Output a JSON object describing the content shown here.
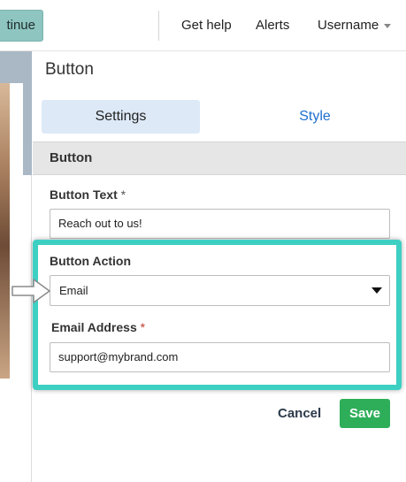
{
  "topnav": {
    "continue_label": "tinue",
    "get_help": "Get help",
    "alerts": "Alerts",
    "username": "Username"
  },
  "panel": {
    "title": "Button",
    "tabs": [
      {
        "label": "Settings",
        "active": true
      },
      {
        "label": "Style",
        "active": false
      }
    ],
    "section_header": "Button",
    "fields": {
      "button_text": {
        "label": "Button Text",
        "required_mark": "*",
        "value": "Reach out to us!"
      },
      "button_action": {
        "label": "Button Action",
        "selected": "Email"
      },
      "email_address": {
        "label": "Email Address",
        "required_mark": "*",
        "value": "support@mybrand.com"
      }
    },
    "actions": {
      "cancel": "Cancel",
      "save": "Save"
    }
  },
  "colors": {
    "highlight": "#3ecfc3",
    "save": "#2fae5a",
    "tab_active_bg": "#dde9f7",
    "tab_link": "#1e6fd0",
    "continue_bg": "#8ec5c0"
  },
  "icons": {
    "username_caret": "chevron-down-icon",
    "select_caret": "caret-down-icon",
    "pointer": "arrow-right-icon"
  }
}
